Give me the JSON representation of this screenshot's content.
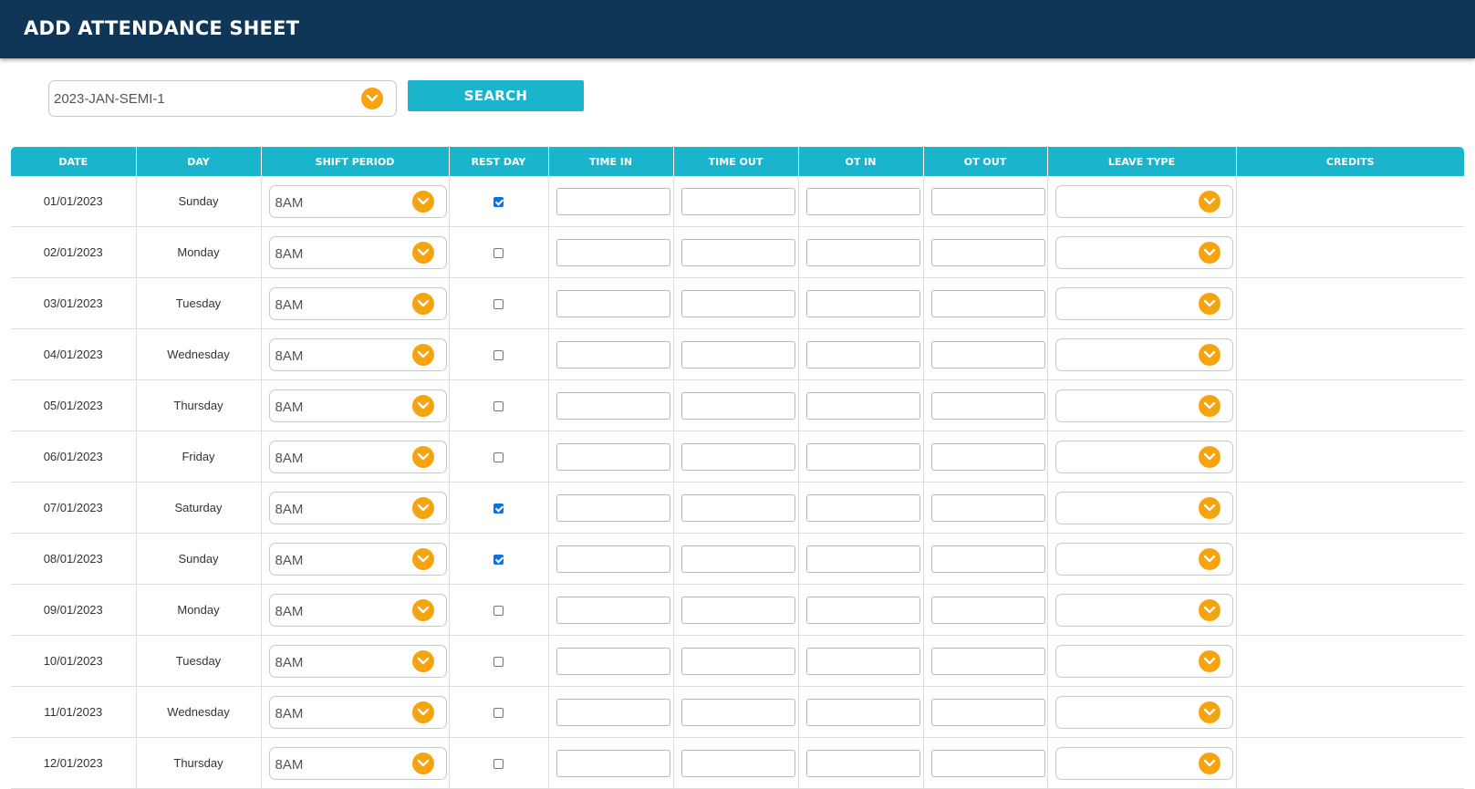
{
  "header": {
    "title": "ADD ATTENDANCE SHEET"
  },
  "filter": {
    "period_value": "2023-JAN-SEMI-1",
    "search_label": "SEARCH"
  },
  "table": {
    "columns": [
      "DATE",
      "DAY",
      "SHIFT PERIOD",
      "REST DAY",
      "TIME IN",
      "TIME OUT",
      "OT IN",
      "OT OUT",
      "LEAVE TYPE",
      "CREDITS"
    ],
    "rows": [
      {
        "date": "01/01/2023",
        "day": "Sunday",
        "shift": "8AM",
        "rest_day": true,
        "time_in": "",
        "time_out": "",
        "ot_in": "",
        "ot_out": "",
        "leave_type": "",
        "credits": ""
      },
      {
        "date": "02/01/2023",
        "day": "Monday",
        "shift": "8AM",
        "rest_day": false,
        "time_in": "",
        "time_out": "",
        "ot_in": "",
        "ot_out": "",
        "leave_type": "",
        "credits": ""
      },
      {
        "date": "03/01/2023",
        "day": "Tuesday",
        "shift": "8AM",
        "rest_day": false,
        "time_in": "",
        "time_out": "",
        "ot_in": "",
        "ot_out": "",
        "leave_type": "",
        "credits": ""
      },
      {
        "date": "04/01/2023",
        "day": "Wednesday",
        "shift": "8AM",
        "rest_day": false,
        "time_in": "",
        "time_out": "",
        "ot_in": "",
        "ot_out": "",
        "leave_type": "",
        "credits": ""
      },
      {
        "date": "05/01/2023",
        "day": "Thursday",
        "shift": "8AM",
        "rest_day": false,
        "time_in": "",
        "time_out": "",
        "ot_in": "",
        "ot_out": "",
        "leave_type": "",
        "credits": ""
      },
      {
        "date": "06/01/2023",
        "day": "Friday",
        "shift": "8AM",
        "rest_day": false,
        "time_in": "",
        "time_out": "",
        "ot_in": "",
        "ot_out": "",
        "leave_type": "",
        "credits": ""
      },
      {
        "date": "07/01/2023",
        "day": "Saturday",
        "shift": "8AM",
        "rest_day": true,
        "time_in": "",
        "time_out": "",
        "ot_in": "",
        "ot_out": "",
        "leave_type": "",
        "credits": ""
      },
      {
        "date": "08/01/2023",
        "day": "Sunday",
        "shift": "8AM",
        "rest_day": true,
        "time_in": "",
        "time_out": "",
        "ot_in": "",
        "ot_out": "",
        "leave_type": "",
        "credits": ""
      },
      {
        "date": "09/01/2023",
        "day": "Monday",
        "shift": "8AM",
        "rest_day": false,
        "time_in": "",
        "time_out": "",
        "ot_in": "",
        "ot_out": "",
        "leave_type": "",
        "credits": ""
      },
      {
        "date": "10/01/2023",
        "day": "Tuesday",
        "shift": "8AM",
        "rest_day": false,
        "time_in": "",
        "time_out": "",
        "ot_in": "",
        "ot_out": "",
        "leave_type": "",
        "credits": ""
      },
      {
        "date": "11/01/2023",
        "day": "Wednesday",
        "shift": "8AM",
        "rest_day": false,
        "time_in": "",
        "time_out": "",
        "ot_in": "",
        "ot_out": "",
        "leave_type": "",
        "credits": ""
      },
      {
        "date": "12/01/2023",
        "day": "Thursday",
        "shift": "8AM",
        "rest_day": false,
        "time_in": "",
        "time_out": "",
        "ot_in": "",
        "ot_out": "",
        "leave_type": "",
        "credits": ""
      }
    ]
  },
  "colors": {
    "header_bg": "#0f3557",
    "accent": "#1ab5cc",
    "dropdown_icon": "#f5a30f",
    "checkbox_checked": "#0b74de"
  },
  "icons": {
    "dropdown": "chevron-down-icon"
  }
}
